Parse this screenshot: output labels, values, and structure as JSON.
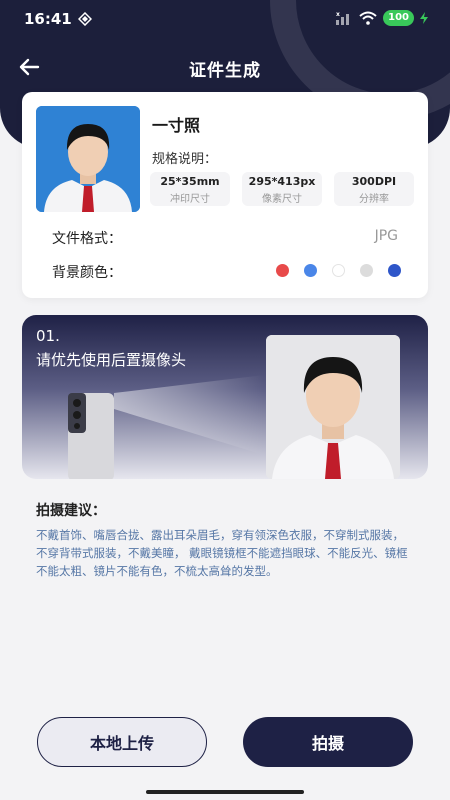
{
  "status_bar": {
    "time": "16:41",
    "battery": "100"
  },
  "nav": {
    "title": "证件生成"
  },
  "photo_card": {
    "title": "一寸照",
    "spec_label": "规格说明：",
    "specs": [
      {
        "value": "25*35mm",
        "label": "冲印尺寸"
      },
      {
        "value": "295*413px",
        "label": "像素尺寸"
      },
      {
        "value": "300DPI",
        "label": "分辨率"
      }
    ],
    "format_label": "文件格式：",
    "format_value": "JPG",
    "bg_label": "背景颜色：",
    "bg_colors": [
      "#e84a4a",
      "#4a86e8",
      "#ffffff",
      "#dcdcdc",
      "#2e56c9"
    ]
  },
  "tip": {
    "number": "01.",
    "text": "请优先使用后置摄像头"
  },
  "advice": {
    "title": "拍摄建议：",
    "text": "不戴首饰、嘴唇合拢、露出耳朵眉毛，穿有领深色衣服，不穿制式服装，不穿背带式服装，不戴美瞳， 戴眼镜镜框不能遮挡眼球、不能反光、镜框不能太粗、镜片不能有色，不梳太高耸的发型。"
  },
  "buttons": {
    "upload": "本地上传",
    "shoot": "拍摄"
  }
}
